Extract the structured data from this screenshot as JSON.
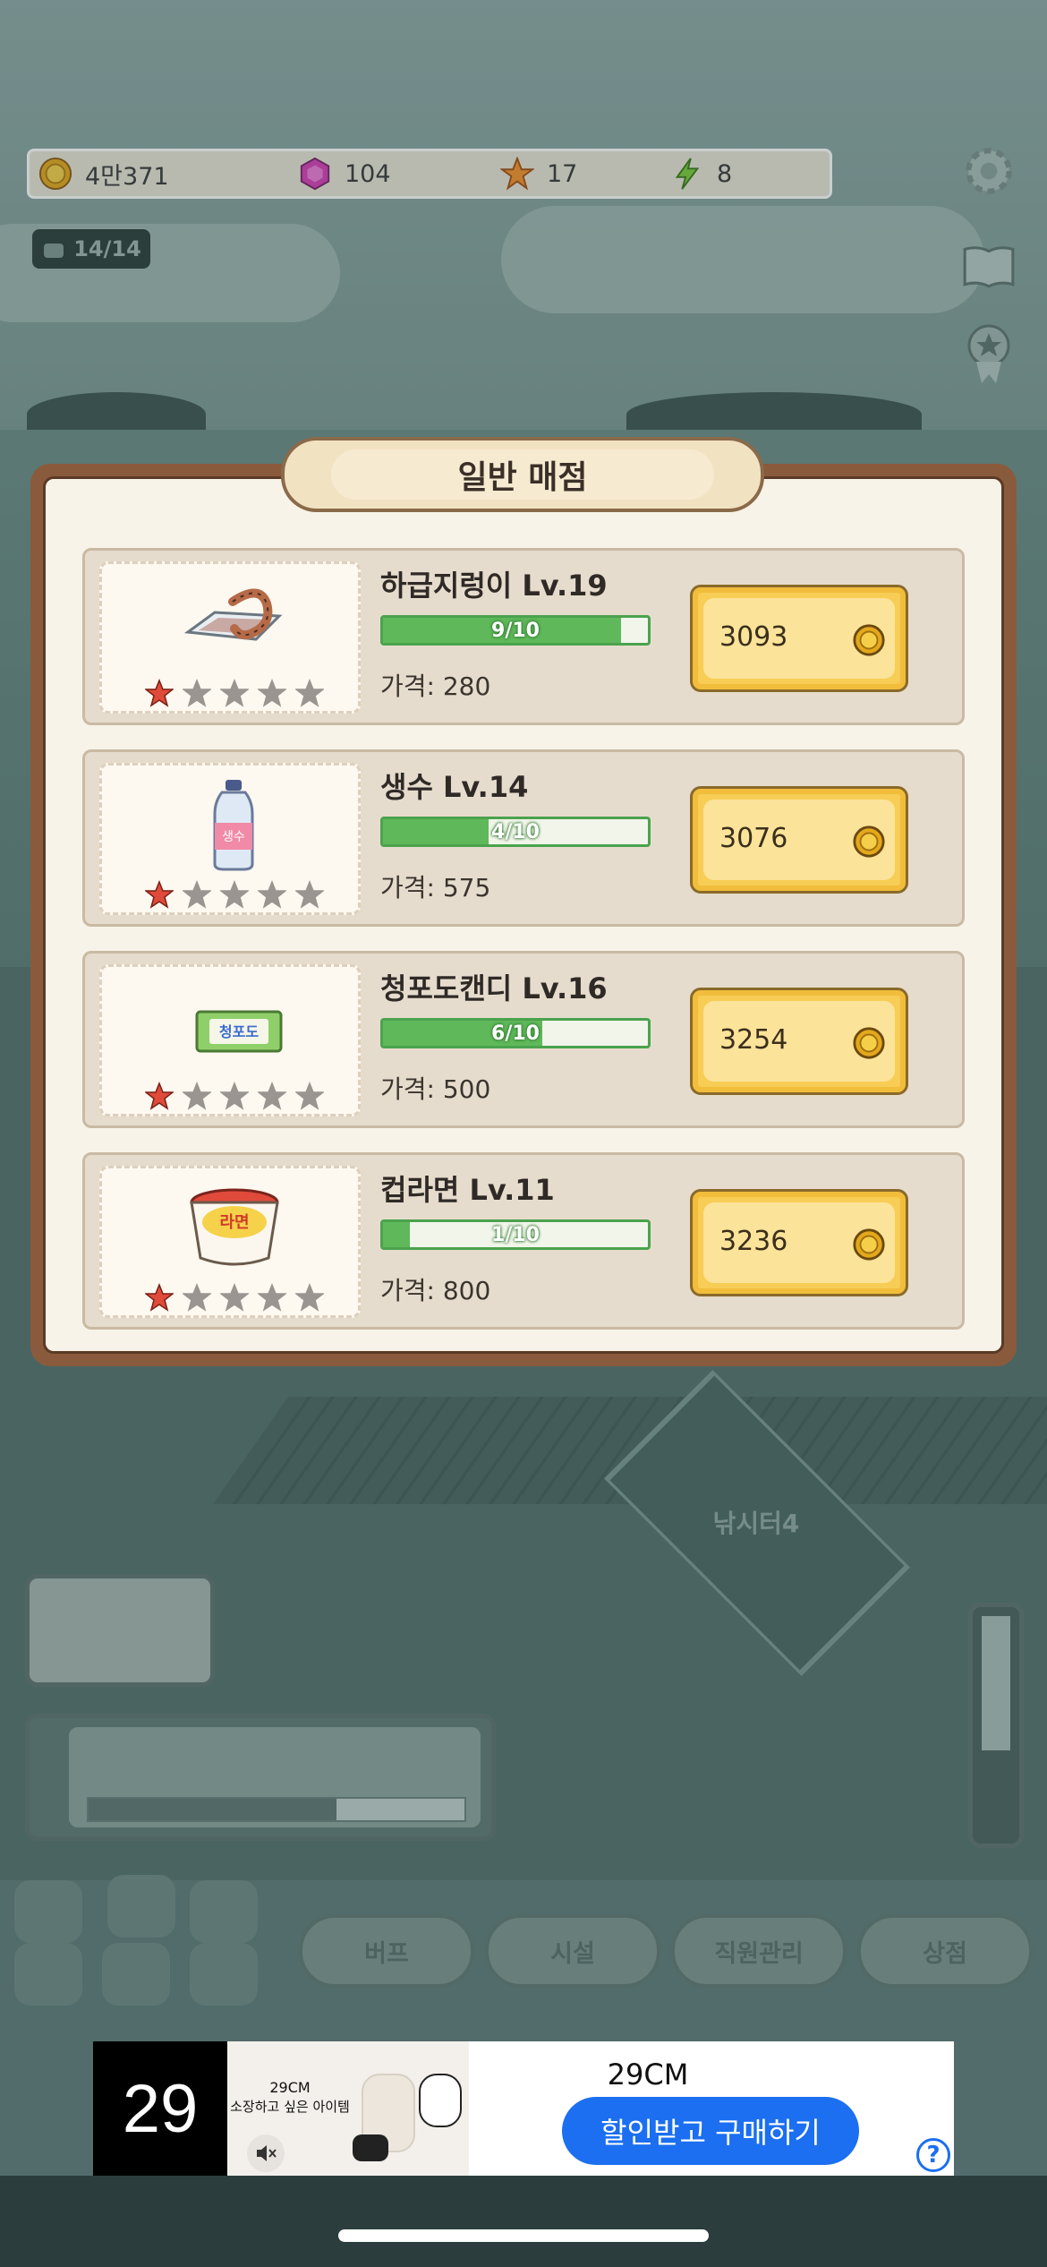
{
  "resources": {
    "coins": "4만371",
    "gems": "104",
    "stars": "17",
    "energy": "8"
  },
  "capacity": "14/14",
  "shop": {
    "title": "일반 매점",
    "items": [
      {
        "name": "하급지렁이 Lv.19",
        "progress_text": "9/10",
        "progress": 0.9,
        "price": "가격: 280",
        "cost": "3093",
        "stars_filled": 1,
        "stars_total": 5,
        "icon": "worm-tray-icon"
      },
      {
        "name": "생수 Lv.14",
        "progress_text": "4/10",
        "progress": 0.4,
        "price": "가격: 575",
        "cost": "3076",
        "stars_filled": 1,
        "stars_total": 5,
        "icon": "water-bottle-icon"
      },
      {
        "name": "청포도캔디 Lv.16",
        "progress_text": "6/10",
        "progress": 0.6,
        "price": "가격: 500",
        "cost": "3254",
        "stars_filled": 1,
        "stars_total": 5,
        "icon": "candy-icon"
      },
      {
        "name": "컵라면 Lv.11",
        "progress_text": "1/10",
        "progress": 0.1,
        "price": "가격: 800",
        "cost": "3236",
        "stars_filled": 1,
        "stars_total": 5,
        "icon": "cup-noodle-icon"
      }
    ]
  },
  "bottom_tabs": [
    "버프",
    "시설",
    "직원관리",
    "상점"
  ],
  "ad": {
    "logo": "29",
    "creative_brand": "29CM",
    "creative_tagline": "소장하고 싶은 아이템",
    "title": "29CM",
    "cta": "할인받고 구매하기",
    "help": "?"
  },
  "colors": {
    "frame": "#8a5a3c",
    "progress_green": "#5fb85a",
    "buy_yellow": "#f7cd55",
    "ad_cta_blue": "#1b6ff0",
    "star_red": "#e04a3a"
  }
}
